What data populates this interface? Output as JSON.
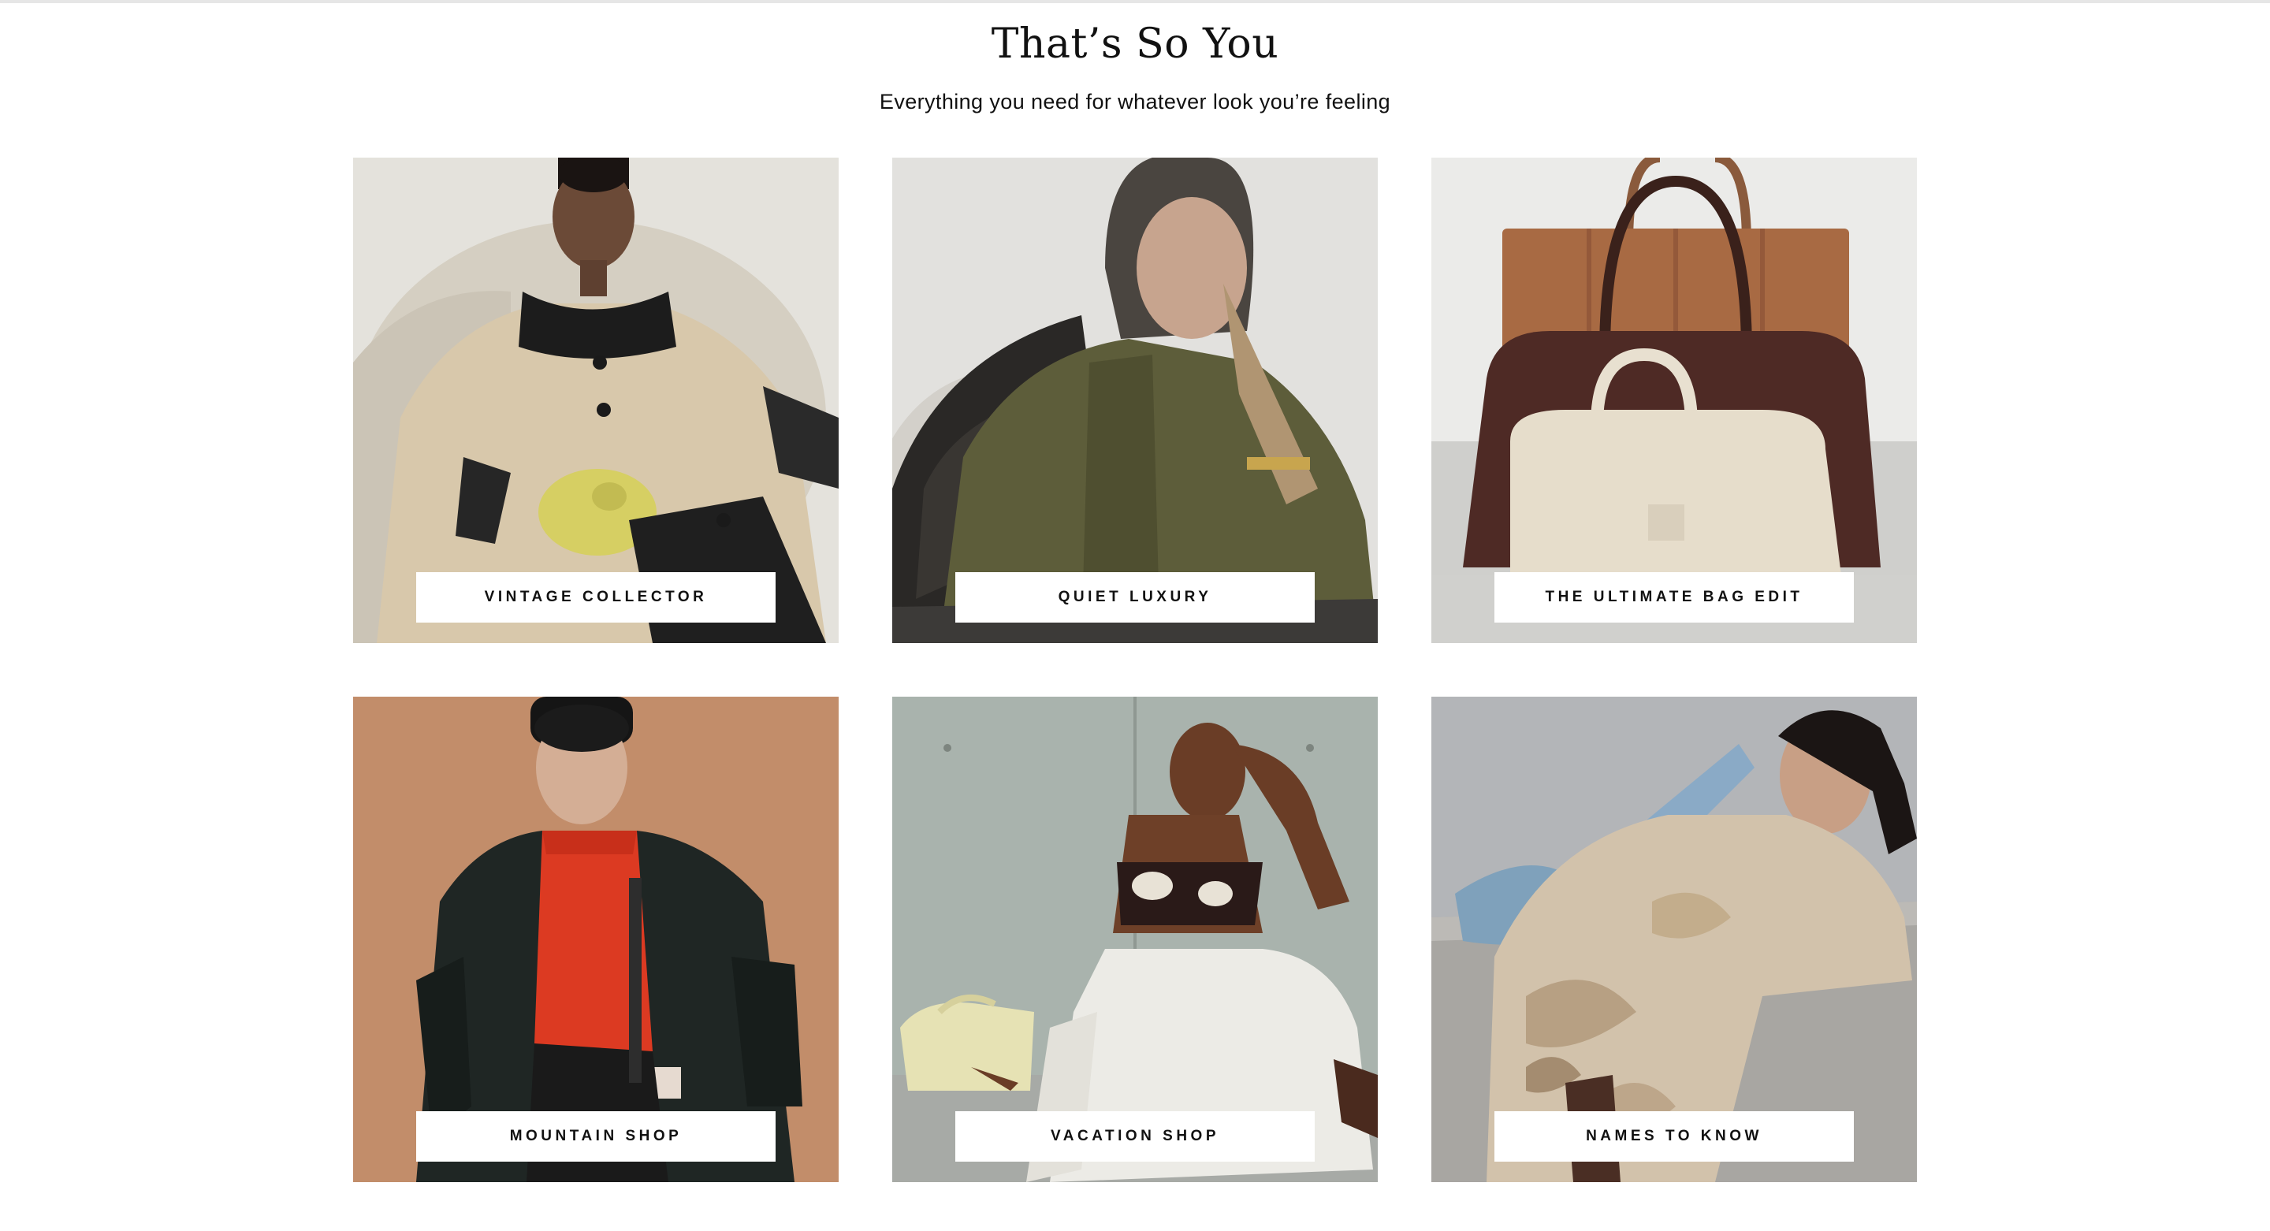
{
  "section": {
    "title": "That’s So You",
    "subtitle": "Everything you need for whatever look you’re feeling"
  },
  "cards": [
    {
      "label": "VINTAGE COLLECTOR",
      "image": "model-in-beige-trench-coat-with-yellow-flower-bag"
    },
    {
      "label": "QUIET LUXURY",
      "image": "model-in-olive-leather-jacket-with-woven-black-bag"
    },
    {
      "label": "THE ULTIMATE BAG EDIT",
      "image": "stacked-brown-tote-burgundy-bag-and-cream-bowling-bag"
    },
    {
      "label": "MOUNTAIN SHOP",
      "image": "model-in-black-puffer-jacket-and-red-turtleneck"
    },
    {
      "label": "VACATION SHOP",
      "image": "model-in-printed-bralette-and-white-skirt-with-cream-bag"
    },
    {
      "label": "NAMES TO KNOW",
      "image": "model-in-floral-ruffled-dress-leaning-on-concrete-wall"
    }
  ]
}
